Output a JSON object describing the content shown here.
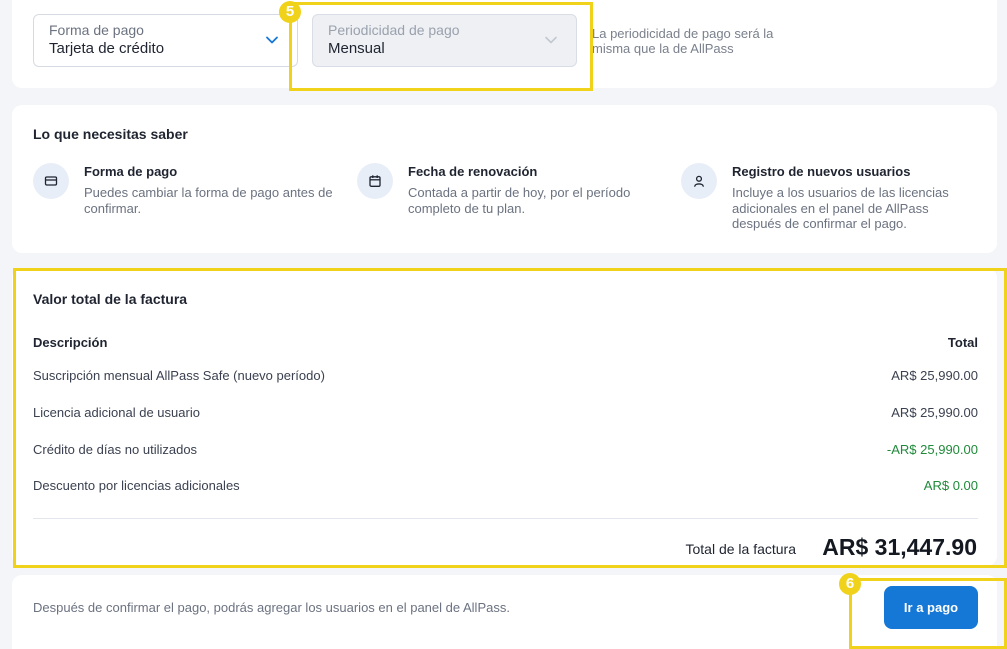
{
  "payment": {
    "method": {
      "label": "Forma de pago",
      "value": "Tarjeta de crédito"
    },
    "period": {
      "label": "Periodicidad de pago",
      "value": "Mensual",
      "note": "La periodicidad de pago será la misma que la de AllPass"
    }
  },
  "markers": {
    "period": "5",
    "pay": "6"
  },
  "info": {
    "title": "Lo que necesitas saber",
    "items": [
      {
        "icon": "credit-card-icon",
        "title": "Forma de pago",
        "desc": "Puedes cambiar la forma de pago antes de confirmar."
      },
      {
        "icon": "calendar-icon",
        "title": "Fecha de renovación",
        "desc": "Contada a partir de hoy, por el período completo de tu plan."
      },
      {
        "icon": "user-icon",
        "title": "Registro de nuevos usuarios",
        "desc": "Incluye a los usuarios de las licencias adicionales en el panel de AllPass después de confirmar el pago."
      }
    ]
  },
  "invoice": {
    "title": "Valor total de la factura",
    "col_desc": "Descripción",
    "col_total": "Total",
    "rows": [
      {
        "desc": "Suscripción mensual AllPass Safe (nuevo período)",
        "amount": "AR$ 25,990.00",
        "positive": false
      },
      {
        "desc": "Licencia adicional de usuario",
        "amount": "AR$ 25,990.00",
        "positive": false
      },
      {
        "desc": "Crédito de días no utilizados",
        "amount": "-AR$ 25,990.00",
        "positive": true
      },
      {
        "desc": "Descuento por licencias adicionales",
        "amount": "AR$ 0.00",
        "positive": true
      }
    ],
    "total_label": "Total de la factura",
    "total_amount": "AR$ 31,447.90"
  },
  "footer": {
    "note": "Después de confirmar el pago, podrás agregar los usuarios en el panel de AllPass.",
    "pay_label": "Ir a pago"
  },
  "colors": {
    "accent": "#1577d6",
    "highlight": "#f0d21a",
    "positive": "#1f8a3a"
  }
}
